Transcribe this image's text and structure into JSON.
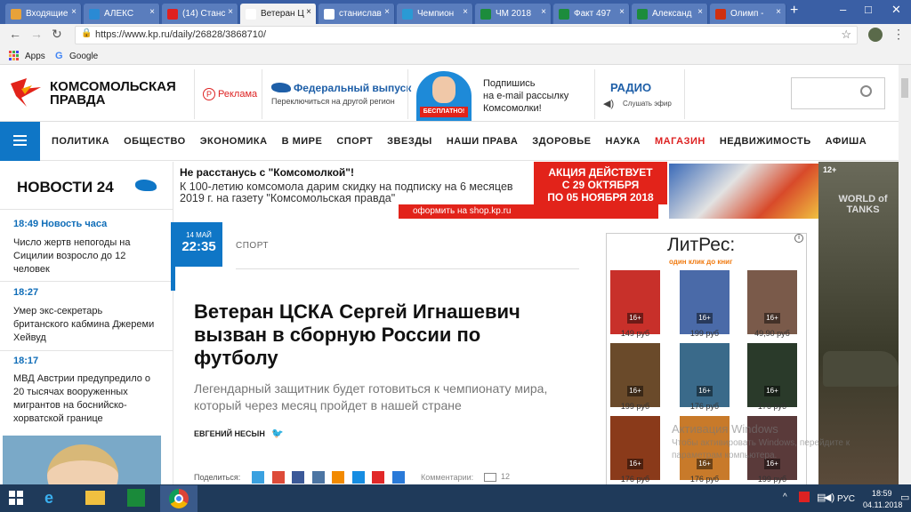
{
  "browser": {
    "tabs": [
      {
        "label": "Входящие",
        "color": "#e8a23a"
      },
      {
        "label": "АЛЕКС",
        "color": "#2a8ad4"
      },
      {
        "label": "(14) Станс",
        "color": "#e02020"
      },
      {
        "label": "Ветеран Ц",
        "color": "#ffffff"
      },
      {
        "label": "станислав",
        "color": "#ffffff"
      },
      {
        "label": "Чемпион",
        "color": "#2a9ad4"
      },
      {
        "label": "ЧМ 2018",
        "color": "#1c8c3c"
      },
      {
        "label": "Факт 497",
        "color": "#1c8c3c"
      },
      {
        "label": "Александ",
        "color": "#1c8c3c"
      },
      {
        "label": "Олимп - ",
        "color": "#d03010"
      }
    ],
    "url": "https://www.kp.ru/daily/26828/3868710/",
    "bookmarks": [
      {
        "label": "Apps"
      },
      {
        "label": "Google"
      }
    ]
  },
  "header": {
    "logo_line1": "КОМСОМОЛЬСКАЯ",
    "logo_line2": "ПРАВДА",
    "ad_label": "Реклама",
    "edition_title": "Федеральный выпуск",
    "edition_sub": "Переключиться на другой регион",
    "subscribe_badge": "БЕСПЛАТНО!",
    "subscribe_text": "Подпишись\nна e-mail рассылку\nКомсомолки!",
    "radio_title": "РАДИО",
    "radio_sub": "Слушать эфир",
    "search_placeholder": ""
  },
  "nav": [
    "ПОЛИТИКА",
    "ОБЩЕСТВО",
    "ЭКОНОМИКА",
    "В МИРЕ",
    "СПОРТ",
    "ЗВЕЗДЫ",
    "НАШИ ПРАВА",
    "ЗДОРОВЬЕ",
    "НАУКА",
    "МАГАЗИН",
    "НЕДВИЖИМОСТЬ",
    "АФИША"
  ],
  "news": {
    "title": "НОВОСТИ 24",
    "items": [
      {
        "time": "18:49 Новость часа",
        "text": "Число жертв непогоды на Сицилии возросло до 12 человек"
      },
      {
        "time": "18:27",
        "text": "Умер экс-секретарь британского кабмина Джереми Хейвуд"
      },
      {
        "time": "18:17",
        "text": "МВД Австрии предупредило о 20 тысячах вооруженных мигрантов на боснийско-хорватской границе"
      }
    ]
  },
  "banner": {
    "headline": "Не расстанусь с \"Комсомолкой\"!",
    "body": "К 100-летию комсомола дарим скидку на подписку на 6 месяцев 2019 г. на газету \"Комсомольская правда\"",
    "promo_line1": "АКЦИЯ ДЕЙСТВУЕТ",
    "promo_line2": "С 29 ОКТЯБРЯ",
    "promo_line3": "ПО 05 НОЯБРЯ 2018",
    "cta": "оформить на shop.kp.ru"
  },
  "article": {
    "date": "14 МАЙ",
    "time": "22:35",
    "section": "СПОРТ",
    "title": "Ветеран ЦСКА Сергей Игнашевич вызван в сборную России по футболу",
    "lead": "Легендарный защитник будет готовиться к чемпионату мира, который через месяц пройдет в нашей стране",
    "author": "ЕВГЕНИЙ НЕСЫН",
    "share_label": "Поделиться:",
    "comments_label": "Комментарии:",
    "comments_count": "12"
  },
  "litres": {
    "brand": "ЛитРес:",
    "tagline": "один клик до книг",
    "books": [
      {
        "price": "149 руб",
        "age": "16+",
        "color": "#c8302a"
      },
      {
        "price": "199 руб",
        "age": "16+",
        "color": "#4a6aa8"
      },
      {
        "price": "49,90 руб",
        "age": "16+",
        "color": "#7a5a4a"
      },
      {
        "price": "199 руб",
        "age": "16+",
        "color": "#6a4a2a"
      },
      {
        "price": "176 руб",
        "age": "16+",
        "color": "#3a6a8a"
      },
      {
        "price": "176 руб",
        "age": "16+",
        "color": "#2a3a2a"
      },
      {
        "price": "176 руб",
        "age": "16+",
        "color": "#8a3a1a"
      },
      {
        "price": "176 руб",
        "age": "16+",
        "color": "#c87a2a"
      },
      {
        "price": "199 руб",
        "age": "16+",
        "color": "#5a3a3a"
      }
    ]
  },
  "side_ad": {
    "age": "12+",
    "brand": "WORLD of TANKS"
  },
  "watermark": {
    "line1": "Активация Windows",
    "line2": "Чтобы активировать Windows, перейдите к",
    "line3": "параметрам компьютера."
  },
  "taskbar": {
    "lang": "РУС",
    "time": "18:59",
    "date": "04.11.2018"
  }
}
